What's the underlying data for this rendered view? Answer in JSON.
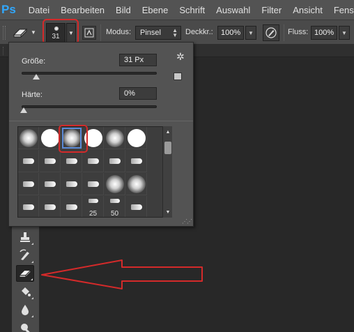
{
  "app": {
    "logo": "Ps"
  },
  "menu": [
    "Datei",
    "Bearbeiten",
    "Bild",
    "Ebene",
    "Schrift",
    "Auswahl",
    "Filter",
    "Ansicht",
    "Fenster"
  ],
  "options_bar": {
    "brush_size": "31",
    "mode_label": "Modus:",
    "mode_value": "Pinsel",
    "opacity_label": "Deckkr.:",
    "opacity_value": "100%",
    "flow_label": "Fluss:",
    "flow_value": "100%"
  },
  "brush_panel": {
    "size_label": "Größe:",
    "size_value": "31 Px",
    "size_fraction": 0.11,
    "hardness_label": "Härte:",
    "hardness_value": "0%",
    "hardness_fraction": 0.0,
    "presets": [
      {
        "kind": "soft"
      },
      {
        "kind": "hard"
      },
      {
        "kind": "soft",
        "selected": true
      },
      {
        "kind": "hard"
      },
      {
        "kind": "soft"
      },
      {
        "kind": "hard"
      },
      {
        "kind": "tip"
      },
      {
        "kind": "tip"
      },
      {
        "kind": "tip"
      },
      {
        "kind": "tip"
      },
      {
        "kind": "tip"
      },
      {
        "kind": "tip"
      },
      {
        "kind": "tip"
      },
      {
        "kind": "tip"
      },
      {
        "kind": "tip"
      },
      {
        "kind": "tip"
      },
      {
        "kind": "soft"
      },
      {
        "kind": "soft"
      },
      {
        "kind": "tip"
      },
      {
        "kind": "tip"
      },
      {
        "kind": "tip"
      },
      {
        "kind": "tip",
        "label": "25"
      },
      {
        "kind": "tip",
        "label": "50"
      },
      {
        "kind": "tip"
      }
    ]
  },
  "tools": [
    {
      "icon": "stamp-icon"
    },
    {
      "icon": "history-brush-icon"
    },
    {
      "icon": "eraser-icon",
      "active": true
    },
    {
      "icon": "paint-bucket-icon"
    },
    {
      "icon": "blur-drop-icon"
    },
    {
      "icon": "dodge-icon"
    }
  ],
  "colors": {
    "annotation": "#d42a2a",
    "selection": "#5a8ad6",
    "accent": "#31a8ff"
  }
}
